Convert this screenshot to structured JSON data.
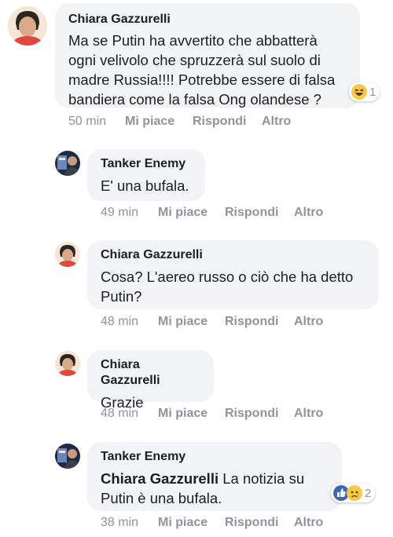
{
  "comments": [
    {
      "author": "Chiara Gazzurelli",
      "lines": [
        "Ma se Putin ha avvertito che abbatterà",
        "ogni velivolo che spruzzerà sul suolo di",
        "madre Russia!!!! Potrebbe essere di falsa",
        "bandiera come la falsa Ong olandese ?"
      ],
      "time": "50 min",
      "like": "Mi piace",
      "reply": "Rispondi",
      "more": "Altro",
      "reactions": {
        "icons": [
          "haha-icon"
        ],
        "count": "1"
      }
    },
    {
      "author": "Tanker Enemy",
      "lines": [
        "E' una bufala."
      ],
      "time": "49 min",
      "like": "Mi piace",
      "reply": "Rispondi",
      "more": "Altro"
    },
    {
      "author": "Chiara Gazzurelli",
      "lines": [
        "Cosa? L'aereo russo o ciò che ha detto",
        "Putin?"
      ],
      "time": "48 min",
      "like": "Mi piace",
      "reply": "Rispondi",
      "more": "Altro"
    },
    {
      "author": "Chiara Gazzurelli",
      "lines": [
        "Grazie"
      ],
      "time": "48 min",
      "like": "Mi piace",
      "reply": "Rispondi",
      "more": "Altro"
    },
    {
      "author": "Tanker Enemy",
      "mention": "Chiara Gazzurelli",
      "lines_after_mention": [
        "La notizia su",
        "Putin è una bufala."
      ],
      "time": "38 min",
      "like": "Mi piace",
      "reply": "Rispondi",
      "more": "Altro",
      "reactions": {
        "icons": [
          "like-icon",
          "sad-icon"
        ],
        "count": "2"
      }
    }
  ],
  "colors": {
    "bubble": "#f2f3f5",
    "meta": "#90949c",
    "like_blue": "#4267b2",
    "emoji_yellow": "#f7c948"
  }
}
